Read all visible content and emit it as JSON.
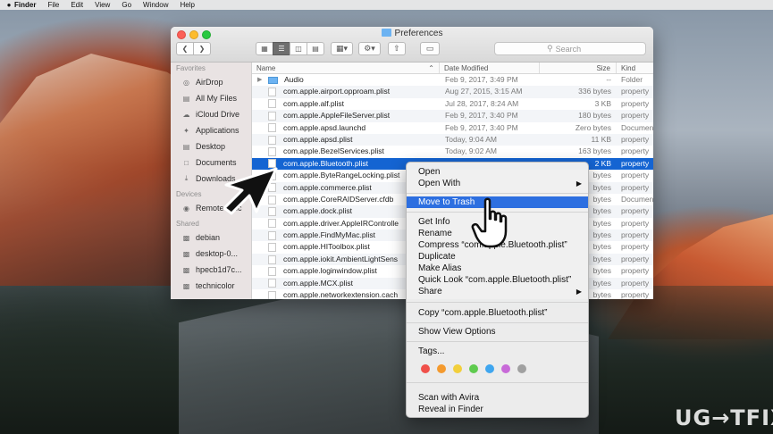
{
  "menubar": {
    "items": [
      "Finder",
      "File",
      "Edit",
      "View",
      "Go",
      "Window",
      "Help"
    ]
  },
  "window": {
    "title": "Preferences",
    "search_placeholder": "Search"
  },
  "sidebar": {
    "favorites_header": "Favorites",
    "favorites": [
      {
        "label": "AirDrop",
        "icon": "airdrop-icon"
      },
      {
        "label": "All My Files",
        "icon": "all-files-icon"
      },
      {
        "label": "iCloud Drive",
        "icon": "cloud-icon"
      },
      {
        "label": "Applications",
        "icon": "applications-icon"
      },
      {
        "label": "Desktop",
        "icon": "desktop-icon"
      },
      {
        "label": "Documents",
        "icon": "documents-icon"
      },
      {
        "label": "Downloads",
        "icon": "downloads-icon"
      }
    ],
    "devices_header": "Devices",
    "devices": [
      {
        "label": "Remote Disc",
        "icon": "disc-icon"
      }
    ],
    "shared_header": "Shared",
    "shared": [
      {
        "label": "debian",
        "icon": "computer-icon"
      },
      {
        "label": "desktop-0...",
        "icon": "computer-icon"
      },
      {
        "label": "hpecb1d7c...",
        "icon": "computer-icon"
      },
      {
        "label": "technicolor",
        "icon": "computer-icon"
      }
    ]
  },
  "columns": {
    "name": "Name",
    "date": "Date Modified",
    "size": "Size",
    "kind": "Kind"
  },
  "files": [
    {
      "name": "Audio",
      "date": "Feb 9, 2017, 3:49 PM",
      "size": "--",
      "kind": "Folder",
      "folder": true
    },
    {
      "name": "com.apple.airport.opproam.plist",
      "date": "Aug 27, 2015, 3:15 AM",
      "size": "336 bytes",
      "kind": "property"
    },
    {
      "name": "com.apple.alf.plist",
      "date": "Jul 28, 2017, 8:24 AM",
      "size": "3 KB",
      "kind": "property"
    },
    {
      "name": "com.apple.AppleFileServer.plist",
      "date": "Feb 9, 2017, 3:40 PM",
      "size": "180 bytes",
      "kind": "property"
    },
    {
      "name": "com.apple.apsd.launchd",
      "date": "Feb 9, 2017, 3:40 PM",
      "size": "Zero bytes",
      "kind": "Document"
    },
    {
      "name": "com.apple.apsd.plist",
      "date": "Today, 9:04 AM",
      "size": "11 KB",
      "kind": "property"
    },
    {
      "name": "com.apple.BezelServices.plist",
      "date": "Today, 9:02 AM",
      "size": "163 bytes",
      "kind": "property"
    },
    {
      "name": "com.apple.Bluetooth.plist",
      "date": "",
      "size": "2 KB",
      "kind": "property",
      "selected": true
    },
    {
      "name": "com.apple.ByteRangeLocking.plist",
      "date": "",
      "size": "bytes",
      "kind": "property"
    },
    {
      "name": "com.apple.commerce.plist",
      "date": "",
      "size": "bytes",
      "kind": "property"
    },
    {
      "name": "com.apple.CoreRAIDServer.cfdb",
      "date": "",
      "size": "bytes",
      "kind": "Document"
    },
    {
      "name": "com.apple.dock.plist",
      "date": "",
      "size": "bytes",
      "kind": "property"
    },
    {
      "name": "com.apple.driver.AppleIRControlle",
      "date": "",
      "size": "bytes",
      "kind": "property"
    },
    {
      "name": "com.apple.FindMyMac.plist",
      "date": "",
      "size": "bytes",
      "kind": "property"
    },
    {
      "name": "com.apple.HIToolbox.plist",
      "date": "",
      "size": "bytes",
      "kind": "property"
    },
    {
      "name": "com.apple.iokit.AmbientLightSens",
      "date": "",
      "size": "bytes",
      "kind": "property"
    },
    {
      "name": "com.apple.loginwindow.plist",
      "date": "",
      "size": "bytes",
      "kind": "property"
    },
    {
      "name": "com.apple.MCX.plist",
      "date": "",
      "size": "bytes",
      "kind": "property"
    },
    {
      "name": "com.apple.networkextension.cach",
      "date": "",
      "size": "bytes",
      "kind": "property"
    }
  ],
  "context_menu": {
    "open": "Open",
    "open_with": "Open With",
    "move_to_trash": "Move to Trash",
    "get_info": "Get Info",
    "rename": "Rename",
    "compress": "Compress “com.apple.Bluetooth.plist”",
    "duplicate": "Duplicate",
    "make_alias": "Make Alias",
    "quick_look": "Quick Look “com.apple.Bluetooth.plist”",
    "share": "Share",
    "copy": "Copy “com.apple.Bluetooth.plist”",
    "show_view_options": "Show View Options",
    "tags": "Tags...",
    "tag_colors": [
      "#f0504a",
      "#f49a2e",
      "#f2cf3c",
      "#5fcb4f",
      "#3fa6ef",
      "#c86ad8",
      "#a0a0a0"
    ],
    "scan_avira": "Scan with Avira",
    "reveal_in_finder": "Reveal in Finder"
  },
  "watermark": "UG→TFIX"
}
